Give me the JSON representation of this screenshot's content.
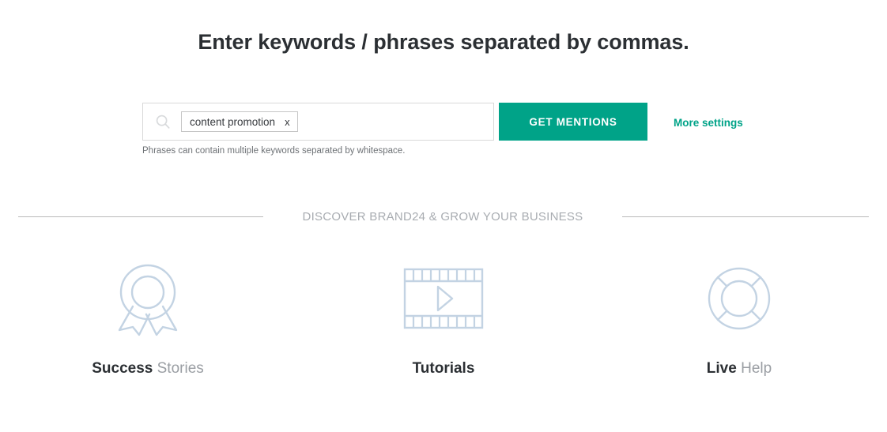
{
  "heading": "Enter keywords / phrases separated by commas.",
  "search": {
    "icon": "search-icon",
    "chip_label": "content promotion",
    "chip_remove_label": "x",
    "input_value": "",
    "input_placeholder": "",
    "hint": "Phrases can contain multiple keywords separated by whitespace.",
    "submit_label": "GET MENTIONS",
    "more_settings_label": "More settings",
    "accent_color": "#00a388"
  },
  "divider": {
    "label": "DISCOVER BRAND24 & GROW YOUR BUSINESS",
    "line_color": "#b9b9b9"
  },
  "features": {
    "icon_color": "#c3d3e3",
    "items": [
      {
        "icon": "award-ribbon-icon",
        "label_strong": "Success",
        "label_light": "Stories"
      },
      {
        "icon": "film-strip-play-icon",
        "label_strong": "Tutorials",
        "label_light": ""
      },
      {
        "icon": "life-ring-icon",
        "label_strong": "Live",
        "label_light": "Help"
      }
    ]
  }
}
